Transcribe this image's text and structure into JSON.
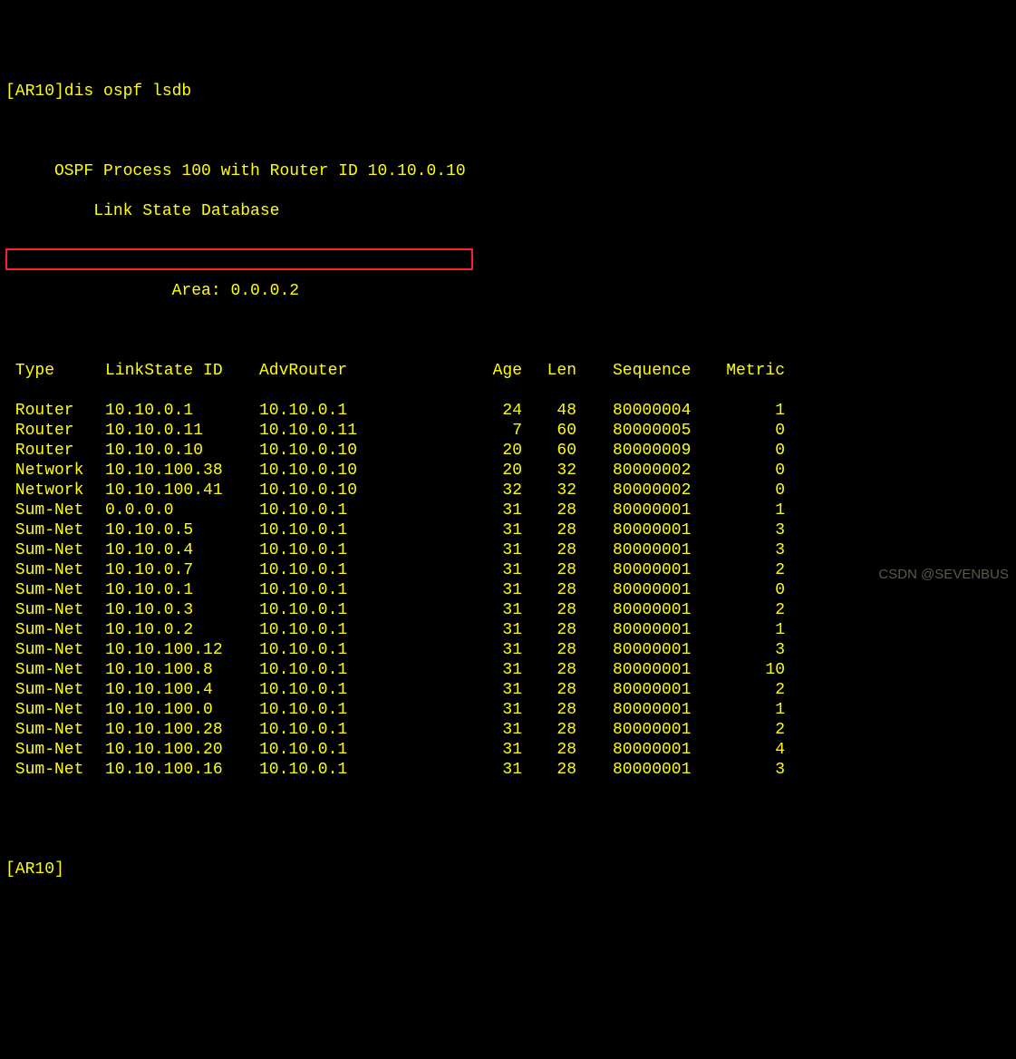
{
  "prompt_line": "[AR10]dis ospf lsdb",
  "blank1": "",
  "header_line1": "     OSPF Process 100 with Router ID 10.10.0.10",
  "header_line2": "         Link State Database",
  "blank2": "",
  "area_line": "                 Area: 0.0.0.2",
  "cols": {
    "type": " Type",
    "lsid": "LinkState ID",
    "adv": "AdvRouter",
    "age": "Age",
    "len": "Len",
    "seq": "Sequence",
    "met": "Metric"
  },
  "rows": [
    {
      "type": " Router",
      "lsid": "10.10.0.1",
      "adv": "10.10.0.1",
      "age": "24",
      "len": "48",
      "seq": "80000004",
      "met": "1"
    },
    {
      "type": " Router",
      "lsid": "10.10.0.11",
      "adv": "10.10.0.11",
      "age": "7",
      "len": "60",
      "seq": "80000005",
      "met": "0"
    },
    {
      "type": " Router",
      "lsid": "10.10.0.10",
      "adv": "10.10.0.10",
      "age": "20",
      "len": "60",
      "seq": "80000009",
      "met": "0"
    },
    {
      "type": " Network",
      "lsid": "10.10.100.38",
      "adv": "10.10.0.10",
      "age": "20",
      "len": "32",
      "seq": "80000002",
      "met": "0"
    },
    {
      "type": " Network",
      "lsid": "10.10.100.41",
      "adv": "10.10.0.10",
      "age": "32",
      "len": "32",
      "seq": "80000002",
      "met": "0"
    },
    {
      "type": " Sum-Net",
      "lsid": "0.0.0.0",
      "adv": "10.10.0.1",
      "age": "31",
      "len": "28",
      "seq": "80000001",
      "met": "1"
    },
    {
      "type": " Sum-Net",
      "lsid": "10.10.0.5",
      "adv": "10.10.0.1",
      "age": "31",
      "len": "28",
      "seq": "80000001",
      "met": "3"
    },
    {
      "type": " Sum-Net",
      "lsid": "10.10.0.4",
      "adv": "10.10.0.1",
      "age": "31",
      "len": "28",
      "seq": "80000001",
      "met": "3"
    },
    {
      "type": " Sum-Net",
      "lsid": "10.10.0.7",
      "adv": "10.10.0.1",
      "age": "31",
      "len": "28",
      "seq": "80000001",
      "met": "2"
    },
    {
      "type": " Sum-Net",
      "lsid": "10.10.0.1",
      "adv": "10.10.0.1",
      "age": "31",
      "len": "28",
      "seq": "80000001",
      "met": "0"
    },
    {
      "type": " Sum-Net",
      "lsid": "10.10.0.3",
      "adv": "10.10.0.1",
      "age": "31",
      "len": "28",
      "seq": "80000001",
      "met": "2"
    },
    {
      "type": " Sum-Net",
      "lsid": "10.10.0.2",
      "adv": "10.10.0.1",
      "age": "31",
      "len": "28",
      "seq": "80000001",
      "met": "1"
    },
    {
      "type": " Sum-Net",
      "lsid": "10.10.100.12",
      "adv": "10.10.0.1",
      "age": "31",
      "len": "28",
      "seq": "80000001",
      "met": "3"
    },
    {
      "type": " Sum-Net",
      "lsid": "10.10.100.8",
      "adv": "10.10.0.1",
      "age": "31",
      "len": "28",
      "seq": "80000001",
      "met": "10"
    },
    {
      "type": " Sum-Net",
      "lsid": "10.10.100.4",
      "adv": "10.10.0.1",
      "age": "31",
      "len": "28",
      "seq": "80000001",
      "met": "2"
    },
    {
      "type": " Sum-Net",
      "lsid": "10.10.100.0",
      "adv": "10.10.0.1",
      "age": "31",
      "len": "28",
      "seq": "80000001",
      "met": "1"
    },
    {
      "type": " Sum-Net",
      "lsid": "10.10.100.28",
      "adv": "10.10.0.1",
      "age": "31",
      "len": "28",
      "seq": "80000001",
      "met": "2"
    },
    {
      "type": " Sum-Net",
      "lsid": "10.10.100.20",
      "adv": "10.10.0.1",
      "age": "31",
      "len": "28",
      "seq": "80000001",
      "met": "4"
    },
    {
      "type": " Sum-Net",
      "lsid": "10.10.100.16",
      "adv": "10.10.0.1",
      "age": "31",
      "len": "28",
      "seq": "80000001",
      "met": "3"
    }
  ],
  "blank3": "",
  "end_prompt": "[AR10]",
  "watermark": "CSDN @SEVENBUS"
}
